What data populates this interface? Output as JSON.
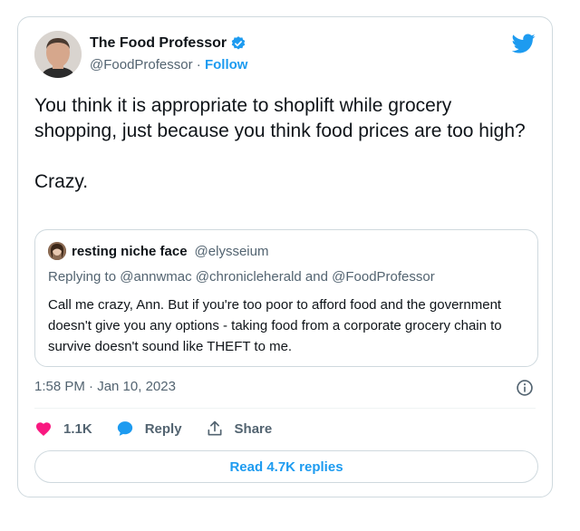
{
  "author": {
    "name": "The Food Professor",
    "handle": "@FoodProfessor",
    "separator": "·",
    "follow_label": "Follow",
    "verified_icon": "verified-badge-icon"
  },
  "tweet": {
    "line1": "You think it is appropriate to shoplift while grocery shopping, just because you think food prices are too high?",
    "line2": "Crazy."
  },
  "quoted": {
    "name": "resting niche face",
    "handle": "@elysseium",
    "replying_to": "Replying to @annwmac @chronicleherald and @FoodProfessor",
    "text": "Call me crazy, Ann. But if you're too poor to afford food and the government doesn't give you any options - taking food from a corporate grocery chain to survive doesn't sound like THEFT to me."
  },
  "timestamp": "1:58 PM · Jan 10, 2023",
  "actions": {
    "like_count": "1.1K",
    "reply_label": "Reply",
    "share_label": "Share"
  },
  "read_replies_label": "Read 4.7K replies",
  "colors": {
    "accent": "#1d9bf0",
    "like": "#f91880",
    "text": "#0f1419",
    "muted": "#536471",
    "border": "#cfd9de"
  }
}
